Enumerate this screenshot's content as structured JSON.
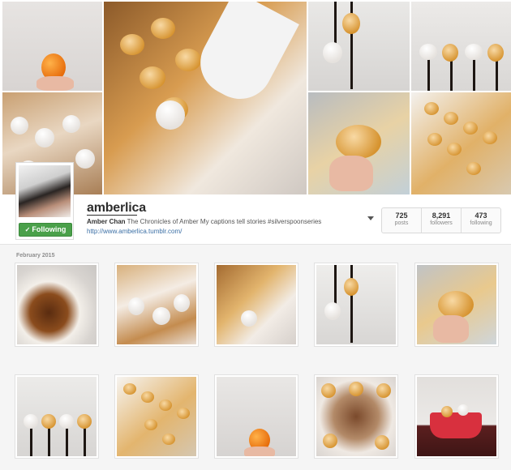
{
  "profile": {
    "username": "amberlica",
    "full_name": "Amber Chan",
    "bio": "The Chronicles of Amber  My captions tell stories #silverspoonseries",
    "website": "http://www.amberlica.tumblr.com/",
    "follow_label": "Following",
    "follow_check": "✓"
  },
  "stats": [
    {
      "value": "725",
      "label": "posts"
    },
    {
      "value": "8,291",
      "label": "followers"
    },
    {
      "value": "473",
      "label": "following"
    }
  ],
  "feed": {
    "month": "February 2015"
  },
  "colors": {
    "follow_green": "#4aa04a",
    "link_blue": "#3b6fa5"
  },
  "icons": {
    "options": "caret-down-icon"
  }
}
